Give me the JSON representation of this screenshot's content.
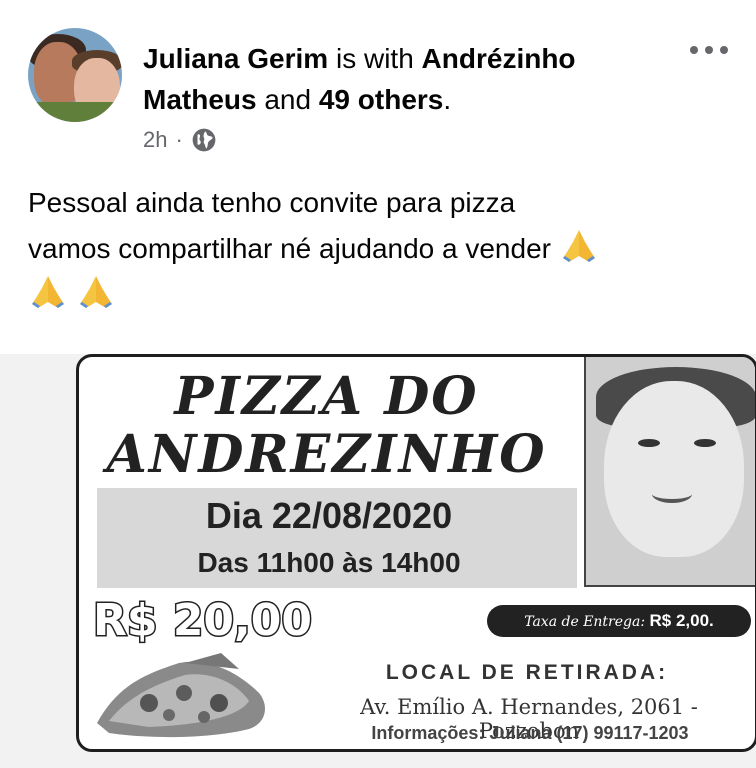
{
  "post": {
    "author": "Juliana Gerim",
    "with_text": "is with",
    "tagged_1": "Andrézinho Matheus",
    "and_text": "and",
    "tagged_2": "49 others",
    "end": ".",
    "time": "2h",
    "separator": "·",
    "privacy_icon": "globe-icon",
    "more_icon": "more-options-icon",
    "text_line1": "Pessoal ainda tenho convite para pizza",
    "text_line2": "vamos compartilhar né ajudando a vender"
  },
  "flyer": {
    "title_line1": "PIZZA DO",
    "title_line2": "ANDREZINHO",
    "date": "Dia 22/08/2020",
    "hours": "Das 11h00 às 14h00",
    "price": "R$ 20,00",
    "delivery_label": "Taxa de Entrega:",
    "delivery_value": "R$ 2,00.",
    "pickup_label": "LOCAL DE RETIRADA:",
    "address": "Av. Emílio A. Hernandes, 2061 - Pozzobon",
    "info": "Informações: Juliana (17) 99117-1203"
  }
}
